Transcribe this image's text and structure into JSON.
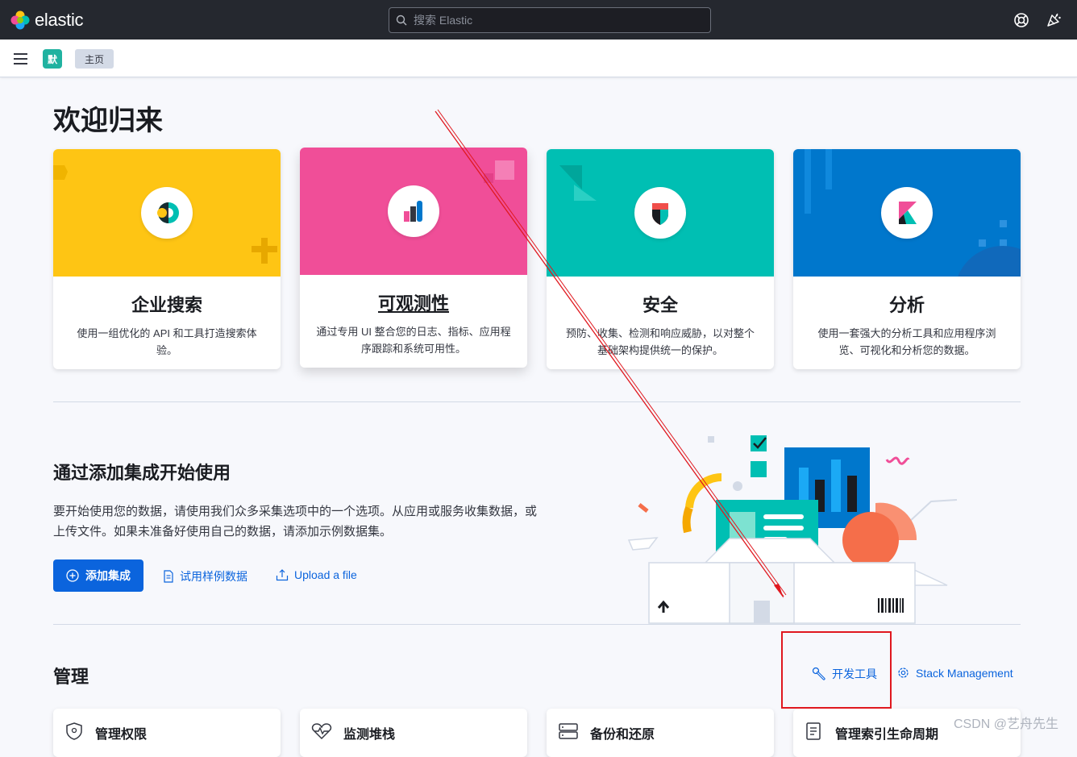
{
  "topbar": {
    "brand": "elastic",
    "search_placeholder": "搜索 Elastic",
    "icons": [
      "help-icon",
      "newsfeed-icon"
    ]
  },
  "subbar": {
    "space_badge": "默",
    "breadcrumb": "主页"
  },
  "welcome": {
    "title": "欢迎归来",
    "cards": [
      {
        "title": "企业搜索",
        "desc": "使用一组优化的 API 和工具打造搜索体验。",
        "color": "#fec514"
      },
      {
        "title": "可观测性",
        "desc": "通过专用 UI 整合您的日志、指标、应用程序跟踪和系统可用性。",
        "color": "#f04e98"
      },
      {
        "title": "安全",
        "desc": "预防、收集、检测和响应威胁，以对整个基础架构提供统一的保护。",
        "color": "#00bfb3"
      },
      {
        "title": "分析",
        "desc": "使用一套强大的分析工具和应用程序浏览、可视化和分析您的数据。",
        "color": "#0077cc"
      }
    ]
  },
  "integrations": {
    "title": "通过添加集成开始使用",
    "description": "要开始使用您的数据，请使用我们众多采集选项中的一个选项。从应用或服务收集数据，或上传文件。如果未准备好使用自己的数据，请添加示例数据集。",
    "add_button": "添加集成",
    "sample_link": "试用样例数据",
    "upload_link": "Upload a file"
  },
  "management": {
    "title": "管理",
    "dev_tools": "开发工具",
    "stack_management": "Stack Management",
    "cards": [
      "管理权限",
      "监测堆栈",
      "备份和还原",
      "管理索引生命周期"
    ]
  },
  "watermark": "CSDN @艺舟先生",
  "colors": {
    "primary": "#0b64dd",
    "topbar": "#25282f",
    "annotation": "#e0181f"
  }
}
